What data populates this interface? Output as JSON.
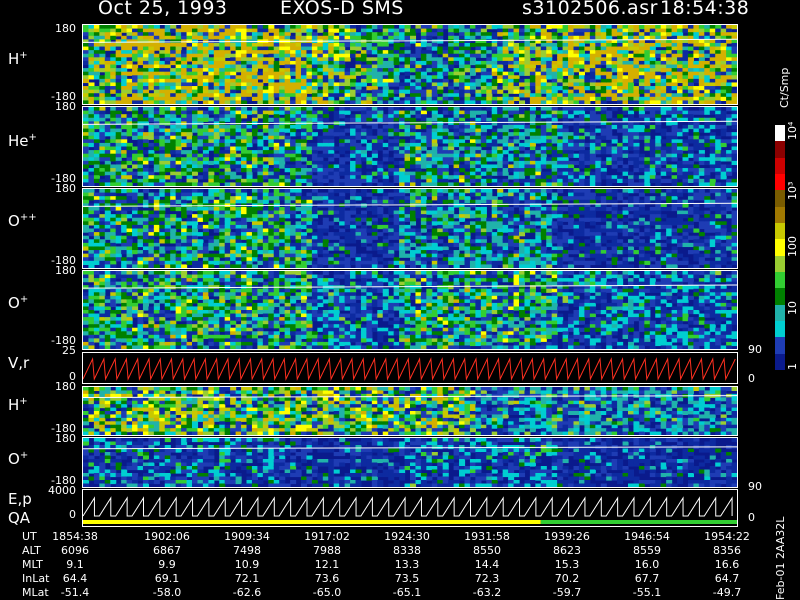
{
  "header": {
    "date": "Oct 25, 1993",
    "mission": "EXOS-D SMS",
    "file": "s3102506.asr",
    "time": "18:54:38"
  },
  "panels": [
    {
      "id": "p1",
      "label": "H",
      "sup": "+",
      "top_tick": "180",
      "bottom_tick": "-180"
    },
    {
      "id": "p2",
      "label": "He",
      "sup": "+",
      "top_tick": "180",
      "bottom_tick": "-180"
    },
    {
      "id": "p3",
      "label": "O",
      "sup": "++",
      "top_tick": "180",
      "bottom_tick": "-180"
    },
    {
      "id": "p4",
      "label": "O",
      "sup": "+",
      "top_tick": "180",
      "bottom_tick": "-180"
    },
    {
      "id": "p5",
      "label": "V,r",
      "sup": "",
      "top_tick": "25",
      "bottom_tick": "0",
      "right_top": "90",
      "right_bottom": "0"
    },
    {
      "id": "p6",
      "label": "H",
      "sup": "+",
      "top_tick": "180",
      "bottom_tick": "-180"
    },
    {
      "id": "p7",
      "label": "O",
      "sup": "+",
      "top_tick": "180",
      "bottom_tick": "-180",
      "right_top": "90"
    },
    {
      "id": "p8",
      "label": "E,p",
      "label2": "QA",
      "top_tick": "4000",
      "bottom_tick": "0",
      "right_bottom": "0"
    }
  ],
  "colorbar": {
    "unit": "Ct/Smp",
    "labels": [
      "10⁴",
      "10³",
      "100",
      "10",
      "1"
    ],
    "colors": [
      "#ffffff",
      "#8b0000",
      "#cc0000",
      "#ff0000",
      "#7a5c00",
      "#a07800",
      "#c8c800",
      "#ffff00",
      "#9acd32",
      "#32cd32",
      "#008000",
      "#20b2aa",
      "#00ced1",
      "#1e3cb4",
      "#0a1a8c"
    ]
  },
  "table": {
    "rows": [
      {
        "name": "UT",
        "values": [
          "1854:38",
          "1902:06",
          "1909:34",
          "1917:02",
          "1924:30",
          "1931:58",
          "1939:26",
          "1946:54",
          "1954:22"
        ]
      },
      {
        "name": "ALT",
        "values": [
          "6096",
          "6867",
          "7498",
          "7988",
          "8338",
          "8550",
          "8623",
          "8559",
          "8356"
        ]
      },
      {
        "name": "MLT",
        "values": [
          "9.1",
          "9.9",
          "10.9",
          "12.1",
          "13.3",
          "14.4",
          "15.3",
          "16.0",
          "16.6"
        ]
      },
      {
        "name": "InLat",
        "values": [
          "64.4",
          "69.1",
          "72.1",
          "73.6",
          "73.5",
          "72.3",
          "70.2",
          "67.7",
          "64.7"
        ]
      },
      {
        "name": "MLat",
        "values": [
          "-51.4",
          "-58.0",
          "-62.6",
          "-65.0",
          "-65.1",
          "-63.2",
          "-59.7",
          "-55.1",
          "-49.7"
        ]
      }
    ]
  },
  "footer_code": "Feb-01 2AA32L",
  "chart_data": {
    "type": "heatmap",
    "x": [
      "1854:38",
      "1902:06",
      "1909:34",
      "1917:02",
      "1924:30",
      "1931:58",
      "1939:26",
      "1946:54",
      "1954:22"
    ],
    "panels": [
      "H+",
      "He+",
      "O++",
      "O+",
      "V,r",
      "H+",
      "O+",
      "E,p QA"
    ],
    "ylim": [
      -180,
      180
    ],
    "colorscale_unit": "Ct/Smp"
  }
}
